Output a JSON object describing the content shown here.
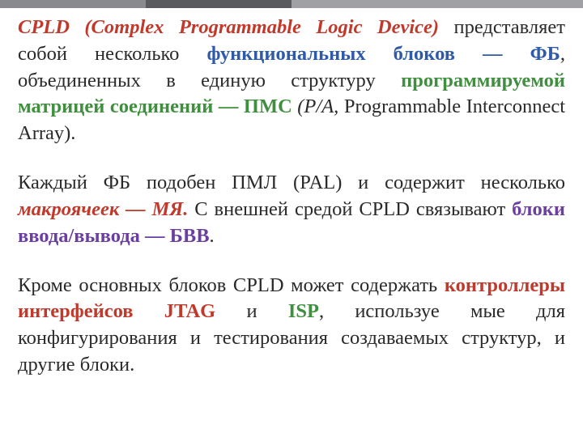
{
  "p1": {
    "s1": "CPLD (Complex Programmable Logic Device)",
    "s2": " представляет собой несколько ",
    "s3": "функциональных блоков — ФБ",
    "s4": ", объединенных в единую структуру ",
    "s5": "программируемой матрицей соединений — ПМС",
    "s6": " (P/A,",
    "s7": " Programmable Interconnect Array)."
  },
  "p2": {
    "s1": "Каждый ФБ подобен ПМЛ (PAL) и содержит несколько ",
    "s2": "макроячеек — МЯ.",
    "s3": " С внешней средой CPLD связывают ",
    "s4": "блоки ввода/вывода — БВВ",
    "s5": "."
  },
  "p3": {
    "s1": "Кроме основных блоков CPLD может содержать ",
    "s2": "контроллеры интерфейсов JTAG",
    "s3": " и ",
    "s4": "ISP",
    "s5": ", используе   мые для конфигурирования и тестирования создаваемых структур, и другие блоки."
  }
}
